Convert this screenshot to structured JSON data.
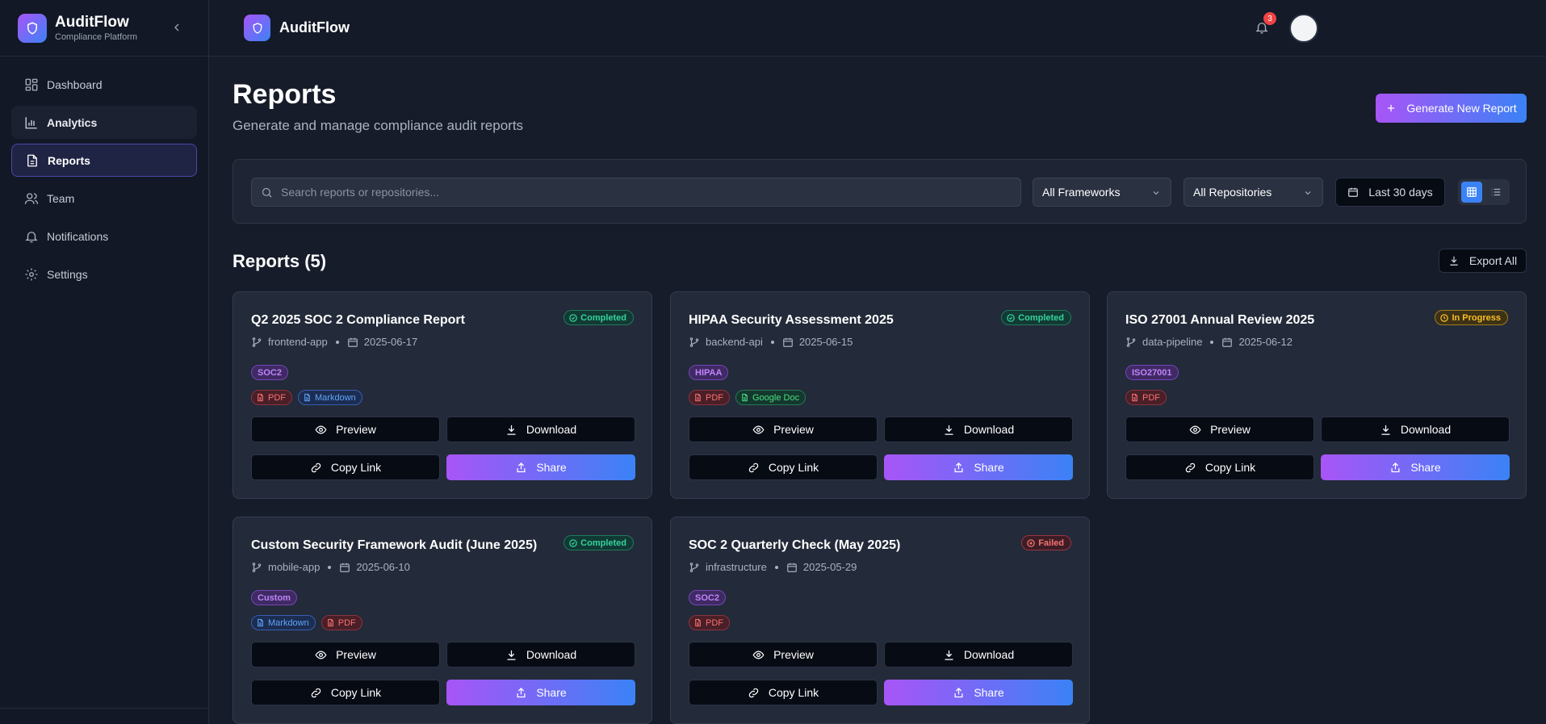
{
  "app": {
    "name": "AuditFlow",
    "subtitle": "Compliance Platform"
  },
  "sidebar": {
    "items": [
      {
        "label": "Dashboard",
        "icon": "dashboard-icon"
      },
      {
        "label": "Analytics",
        "icon": "bar-chart-icon"
      },
      {
        "label": "Reports",
        "icon": "file-text-icon"
      },
      {
        "label": "Team",
        "icon": "users-icon"
      },
      {
        "label": "Notifications",
        "icon": "bell-icon"
      },
      {
        "label": "Settings",
        "icon": "gear-icon"
      }
    ],
    "active": "Reports",
    "hovered": "Analytics"
  },
  "topbar": {
    "title": "AuditFlow",
    "notification_count": "3"
  },
  "page": {
    "title": "Reports",
    "subtitle": "Generate and manage compliance audit reports",
    "generate_label": "Generate New Report"
  },
  "filters": {
    "search_placeholder": "Search reports or repositories...",
    "framework": "All Frameworks",
    "repository": "All Repositories",
    "date_range": "Last 30 days",
    "view_mode": "grid"
  },
  "reports_section": {
    "title": "Reports (5)",
    "export_label": "Export All"
  },
  "actions": {
    "preview": "Preview",
    "download": "Download",
    "copy_link": "Copy Link",
    "share": "Share"
  },
  "reports": [
    {
      "title": "Q2 2025 SOC 2 Compliance Report",
      "status": "Completed",
      "repo": "frontend-app",
      "date": "2025-06-17",
      "framework": "SOC2",
      "formats": [
        "PDF",
        "Markdown"
      ]
    },
    {
      "title": "HIPAA Security Assessment 2025",
      "status": "Completed",
      "repo": "backend-api",
      "date": "2025-06-15",
      "framework": "HIPAA",
      "formats": [
        "PDF",
        "Google Doc"
      ]
    },
    {
      "title": "ISO 27001 Annual Review 2025",
      "status": "In Progress",
      "repo": "data-pipeline",
      "date": "2025-06-12",
      "framework": "ISO27001",
      "formats": [
        "PDF"
      ]
    },
    {
      "title": "Custom Security Framework Audit (June 2025)",
      "status": "Completed",
      "repo": "mobile-app",
      "date": "2025-06-10",
      "framework": "Custom",
      "formats": [
        "Markdown",
        "PDF"
      ]
    },
    {
      "title": "SOC 2 Quarterly Check (May 2025)",
      "status": "Failed",
      "repo": "infrastructure",
      "date": "2025-05-29",
      "framework": "SOC2",
      "formats": [
        "PDF"
      ]
    }
  ],
  "colors": {
    "accent_start": "#a855f7",
    "accent_end": "#3b82f6",
    "completed": "#34d399",
    "in_progress": "#fbbf24",
    "failed": "#f87171"
  }
}
